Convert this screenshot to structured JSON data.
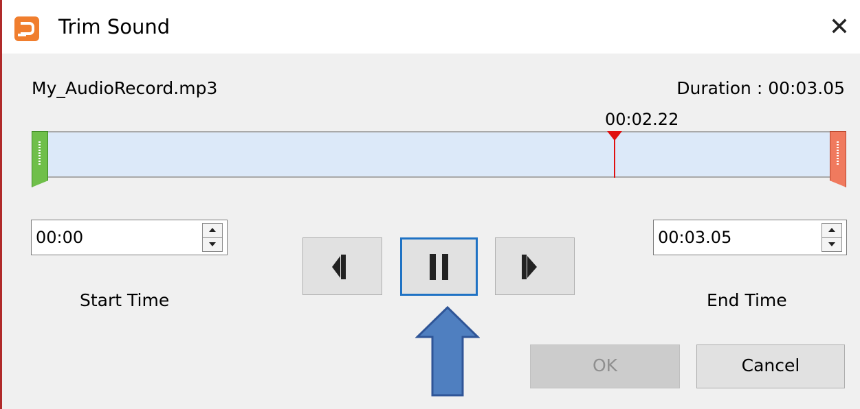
{
  "window": {
    "title": "Trim Sound",
    "close_icon": "close-icon",
    "app_icon": "powerpoint-icon"
  },
  "file": {
    "name": "My_AudioRecord.mp3",
    "duration_text": "Duration : 00:03.05"
  },
  "timeline": {
    "playhead_time": "00:02.22",
    "playhead_fraction": 0.728,
    "colors": {
      "track": "#dce9f9",
      "start_handle": "#6fbf4a",
      "end_handle": "#f07a5e",
      "playhead": "#e01010"
    }
  },
  "start_time": {
    "value": "00:00",
    "label": "Start Time"
  },
  "end_time": {
    "value": "00:03.05",
    "label": "End Time"
  },
  "playback": {
    "previous_icon": "previous-frame-icon",
    "pause_icon": "pause-icon",
    "next_icon": "next-frame-icon",
    "focus_color": "#1f72c4"
  },
  "annotation": {
    "arrow_icon": "up-arrow-icon",
    "arrow_color": "#4f7fc0"
  },
  "buttons": {
    "ok_label": "OK",
    "cancel_label": "Cancel"
  }
}
